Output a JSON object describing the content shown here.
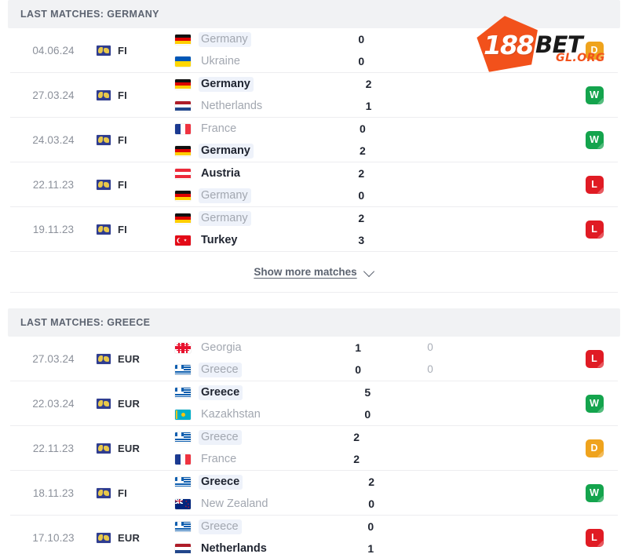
{
  "sections": [
    {
      "header": "LAST MATCHES: GERMANY",
      "matches": [
        {
          "date": "04.06.24",
          "competition": "FI",
          "competition_icon": "world-globe-icon",
          "home": {
            "team": "Germany",
            "flag": "de",
            "winner": false,
            "highlight": true
          },
          "away": {
            "team": "Ukraine",
            "flag": "ua",
            "winner": false,
            "highlight": false
          },
          "score_home": "0",
          "score_away": "0",
          "score2_home": "",
          "score2_away": "",
          "result": "D"
        },
        {
          "date": "27.03.24",
          "competition": "FI",
          "competition_icon": "world-globe-icon",
          "home": {
            "team": "Germany",
            "flag": "de",
            "winner": true,
            "highlight": true
          },
          "away": {
            "team": "Netherlands",
            "flag": "nl",
            "winner": false,
            "highlight": false
          },
          "score_home": "2",
          "score_away": "1",
          "score2_home": "",
          "score2_away": "",
          "result": "W"
        },
        {
          "date": "24.03.24",
          "competition": "FI",
          "competition_icon": "world-globe-icon",
          "home": {
            "team": "France",
            "flag": "fr",
            "winner": false,
            "highlight": false
          },
          "away": {
            "team": "Germany",
            "flag": "de",
            "winner": true,
            "highlight": true
          },
          "score_home": "0",
          "score_away": "2",
          "score2_home": "",
          "score2_away": "",
          "result": "W"
        },
        {
          "date": "22.11.23",
          "competition": "FI",
          "competition_icon": "world-globe-icon",
          "home": {
            "team": "Austria",
            "flag": "at",
            "winner": true,
            "highlight": false
          },
          "away": {
            "team": "Germany",
            "flag": "de",
            "winner": false,
            "highlight": true
          },
          "score_home": "2",
          "score_away": "0",
          "score2_home": "",
          "score2_away": "",
          "result": "L"
        },
        {
          "date": "19.11.23",
          "competition": "FI",
          "competition_icon": "world-globe-icon",
          "home": {
            "team": "Germany",
            "flag": "de",
            "winner": false,
            "highlight": true
          },
          "away": {
            "team": "Turkey",
            "flag": "tr",
            "winner": true,
            "highlight": false
          },
          "score_home": "2",
          "score_away": "3",
          "score2_home": "",
          "score2_away": "",
          "result": "L"
        }
      ],
      "show_more": "Show more matches",
      "show_more_icon": "chevron-down-icon"
    },
    {
      "header": "LAST MATCHES: GREECE",
      "matches": [
        {
          "date": "27.03.24",
          "competition": "EUR",
          "competition_icon": "world-globe-icon",
          "home": {
            "team": "Georgia",
            "flag": "ge",
            "winner": false,
            "highlight": false
          },
          "away": {
            "team": "Greece",
            "flag": "gr",
            "winner": false,
            "highlight": true
          },
          "score_home": "1",
          "score_away": "0",
          "score2_home": "0",
          "score2_away": "0",
          "result": "L"
        },
        {
          "date": "22.03.24",
          "competition": "EUR",
          "competition_icon": "world-globe-icon",
          "home": {
            "team": "Greece",
            "flag": "gr",
            "winner": true,
            "highlight": true
          },
          "away": {
            "team": "Kazakhstan",
            "flag": "kz",
            "winner": false,
            "highlight": false
          },
          "score_home": "5",
          "score_away": "0",
          "score2_home": "",
          "score2_away": "",
          "result": "W"
        },
        {
          "date": "22.11.23",
          "competition": "EUR",
          "competition_icon": "world-globe-icon",
          "home": {
            "team": "Greece",
            "flag": "gr",
            "winner": false,
            "highlight": true
          },
          "away": {
            "team": "France",
            "flag": "fr",
            "winner": false,
            "highlight": false
          },
          "score_home": "2",
          "score_away": "2",
          "score2_home": "",
          "score2_away": "",
          "result": "D"
        },
        {
          "date": "18.11.23",
          "competition": "FI",
          "competition_icon": "world-globe-icon",
          "home": {
            "team": "Greece",
            "flag": "gr",
            "winner": true,
            "highlight": true
          },
          "away": {
            "team": "New Zealand",
            "flag": "nz",
            "winner": false,
            "highlight": false
          },
          "score_home": "2",
          "score_away": "0",
          "score2_home": "",
          "score2_away": "",
          "result": "W"
        },
        {
          "date": "17.10.23",
          "competition": "EUR",
          "competition_icon": "world-globe-icon",
          "home": {
            "team": "Greece",
            "flag": "gr",
            "winner": false,
            "highlight": true
          },
          "away": {
            "team": "Netherlands",
            "flag": "nl",
            "winner": true,
            "highlight": false
          },
          "score_home": "0",
          "score_away": "1",
          "score2_home": "",
          "score2_away": "",
          "result": "L"
        }
      ]
    }
  ],
  "watermark": {
    "primary": "188",
    "secondary": "BET",
    "domain": "GL.ORG",
    "color_primary": "#f2511b",
    "color_secondary": "#1a1a1a"
  },
  "colors": {
    "win": "#14a44d",
    "loss": "#e01b24",
    "draw": "#efa31d",
    "header_bg": "#f1f2f4",
    "row_border": "#ededf0",
    "name_muted": "#a2a7b0",
    "name_bold": "#1f2430"
  }
}
